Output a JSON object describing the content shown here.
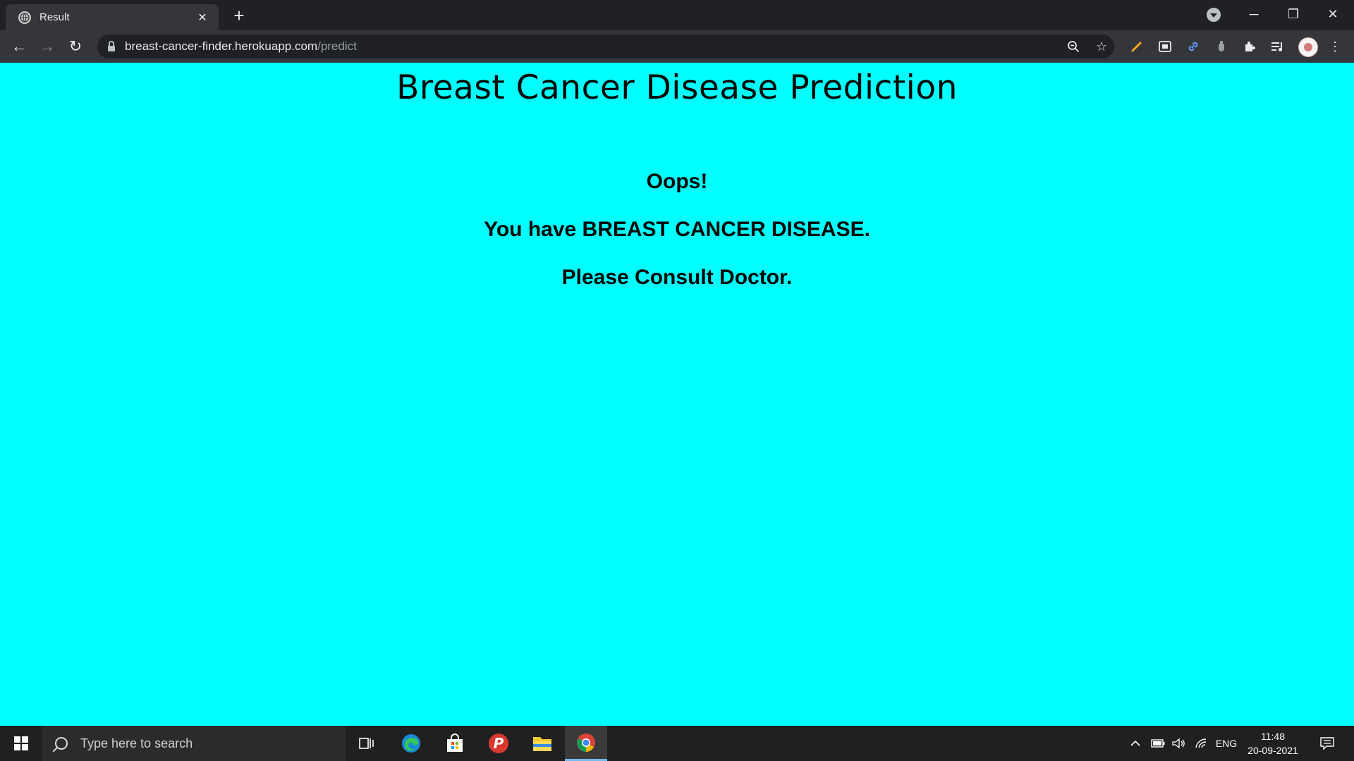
{
  "browser": {
    "tab": {
      "title": "Result",
      "close": "✕",
      "favicon": "globe-icon"
    },
    "new_tab": "+",
    "window_controls": {
      "minimize": "─",
      "restore": "❐",
      "close": "✕"
    },
    "url_host": "breast-cancer-finder.herokuapp.com",
    "url_path": "/predict",
    "nav": {
      "back": "←",
      "forward": "→",
      "reload": "↻"
    },
    "omnibox_icons": [
      "zoom-icon",
      "bookmark-star-icon"
    ],
    "extensions": [
      "pencil-extension-icon",
      "picture-in-picture-icon",
      "link-extension-icon",
      "extension-icon",
      "puzzle-icon",
      "media-control-icon"
    ],
    "menu": "⋮"
  },
  "page": {
    "background_color": "#00ffff",
    "title": "Breast Cancer Disease Prediction",
    "line1": "Oops!",
    "line2": "You have BREAST CANCER DISEASE.",
    "line3": "Please Consult Doctor."
  },
  "taskbar": {
    "search_placeholder": "Type here to search",
    "apps": [
      "task-view-icon",
      "edge-icon",
      "store-icon",
      "psiphon-icon",
      "file-explorer-icon",
      "chrome-icon"
    ],
    "language": "ENG",
    "time": "11:48",
    "date": "20-09-2021"
  }
}
